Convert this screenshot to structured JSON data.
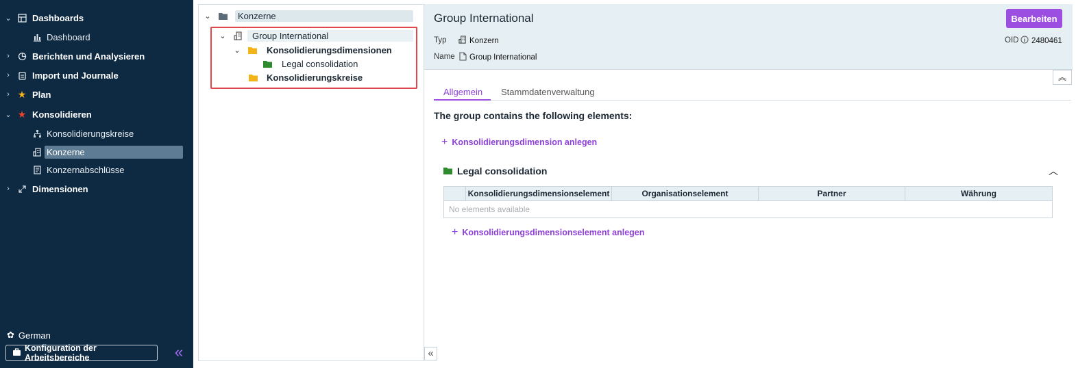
{
  "sidebar": {
    "items": [
      {
        "label": "Dashboards",
        "icon": "grid-icon",
        "expanded": true
      },
      {
        "label": "Dashboard",
        "icon": "bar-chart-icon"
      },
      {
        "label": "Berichten und Analysieren",
        "icon": "pie-chart-icon",
        "expanded": false
      },
      {
        "label": "Import und Journale",
        "icon": "clipboard-icon",
        "expanded": false
      },
      {
        "label": "Plan",
        "icon": "star-icon",
        "expanded": false
      },
      {
        "label": "Konsolidieren",
        "icon": "star-icon",
        "expanded": true
      },
      {
        "label": "Konsolidierungskreise",
        "icon": "hierarchy-icon"
      },
      {
        "label": "Konzerne",
        "icon": "building-icon",
        "active": true
      },
      {
        "label": "Konzernabschlüsse",
        "icon": "document-list-icon"
      },
      {
        "label": "Dimensionen",
        "icon": "expand-arrows-icon",
        "expanded": false
      }
    ],
    "language": "German",
    "workspace_button": "Konfiguration der Arbeitsbereiche",
    "collapse_symbol": "«"
  },
  "tree": {
    "root": "Konzerne",
    "group": "Group International",
    "dimensions": "Konsolidierungsdimensionen",
    "dimension_item": "Legal consolidation",
    "circles": "Konsolidierungskreise",
    "collapse_symbol": "«"
  },
  "detail": {
    "title": "Group International",
    "edit_label": "Bearbeiten",
    "type_label": "Typ",
    "type_value": "Konzern",
    "name_label": "Name",
    "name_value": "Group International",
    "oid_label": "OID",
    "oid_value": "2480461",
    "tabs": [
      "Allgemein",
      "Stammdatenverwaltung"
    ],
    "section_heading": "The group contains the following elements:",
    "add_dimension": "Konsolidierungsdimension anlegen",
    "group_name": "Legal consolidation",
    "table_columns": [
      "Konsolidierungsdimensionselement",
      "Organisationselement",
      "Partner",
      "Währung"
    ],
    "table_empty": "No elements available",
    "add_element": "Konsolidierungsdimensionselement anlegen"
  },
  "colors": {
    "sidebar_bg": "#0e2a43",
    "accent": "#9c4ee0",
    "folder_yellow": "#f2b418",
    "folder_green": "#2e8b2e",
    "highlight_red": "#e0474c"
  }
}
